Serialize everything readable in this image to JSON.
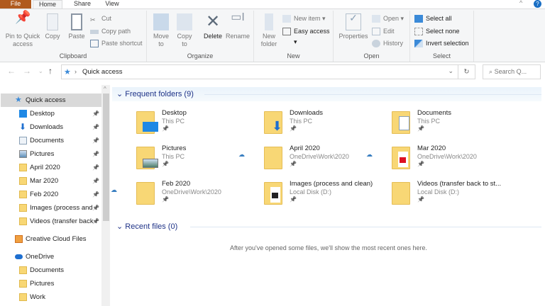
{
  "tabs": {
    "file": "File",
    "home": "Home",
    "share": "Share",
    "view": "View"
  },
  "ribbon": {
    "clipboard": {
      "label": "Clipboard",
      "pin": "Pin to Quick access",
      "copy": "Copy",
      "paste": "Paste",
      "cut": "Cut",
      "copy_path": "Copy path",
      "paste_shortcut": "Paste shortcut"
    },
    "organize": {
      "label": "Organize",
      "move_to": "Move to",
      "copy_to": "Copy to",
      "delete": "Delete",
      "rename": "Rename"
    },
    "new": {
      "label": "New",
      "new_folder": "New folder",
      "new_item": "New item",
      "easy_access": "Easy access"
    },
    "open": {
      "label": "Open",
      "properties": "Properties",
      "open": "Open",
      "edit": "Edit",
      "history": "History"
    },
    "select": {
      "label": "Select",
      "select_all": "Select all",
      "select_none": "Select none",
      "invert": "Invert selection"
    }
  },
  "address": {
    "path": "Quick access",
    "search_placeholder": "Search Q..."
  },
  "sidebar": {
    "items": [
      {
        "label": "Quick access",
        "indent": 0,
        "icon": "star-icon",
        "pinned": false
      },
      {
        "label": "Desktop",
        "indent": 1,
        "icon": "desktop-icon",
        "pinned": true
      },
      {
        "label": "Downloads",
        "indent": 1,
        "icon": "download-icon",
        "pinned": true
      },
      {
        "label": "Documents",
        "indent": 1,
        "icon": "document-icon",
        "pinned": true
      },
      {
        "label": "Pictures",
        "indent": 1,
        "icon": "picture-icon",
        "pinned": true
      },
      {
        "label": "April 2020",
        "indent": 1,
        "icon": "folder-icon",
        "pinned": true
      },
      {
        "label": "Mar 2020",
        "indent": 1,
        "icon": "folder-icon",
        "pinned": true
      },
      {
        "label": "Feb 2020",
        "indent": 1,
        "icon": "folder-icon",
        "pinned": true
      },
      {
        "label": "Images (process and",
        "indent": 1,
        "icon": "folder-icon",
        "pinned": true
      },
      {
        "label": "Videos (transfer back",
        "indent": 1,
        "icon": "folder-icon",
        "pinned": true
      },
      {
        "label": "Creative Cloud Files",
        "indent": 0,
        "icon": "creative-cloud-icon",
        "pinned": false
      },
      {
        "label": "OneDrive",
        "indent": 0,
        "icon": "onedrive-icon",
        "pinned": false
      },
      {
        "label": "Documents",
        "indent": 1,
        "icon": "folder-icon",
        "pinned": false
      },
      {
        "label": "Pictures",
        "indent": 1,
        "icon": "folder-icon",
        "pinned": false
      },
      {
        "label": "Work",
        "indent": 1,
        "icon": "folder-icon",
        "pinned": false
      }
    ]
  },
  "frequent": {
    "header": "Frequent folders (9)",
    "folders": [
      {
        "name": "Desktop",
        "location": "This PC",
        "cloud": false,
        "overlay": "desktop"
      },
      {
        "name": "Downloads",
        "location": "This PC",
        "cloud": false,
        "overlay": "download"
      },
      {
        "name": "Documents",
        "location": "This PC",
        "cloud": false,
        "overlay": "document"
      },
      {
        "name": "Pictures",
        "location": "This PC",
        "cloud": false,
        "overlay": "picture"
      },
      {
        "name": "April 2020",
        "location": "OneDrive\\Work\\2020",
        "cloud": true,
        "overlay": "none"
      },
      {
        "name": "Mar 2020",
        "location": "OneDrive\\Work\\2020",
        "cloud": true,
        "overlay": "pdf"
      },
      {
        "name": "Feb 2020",
        "location": "OneDrive\\Work\\2020",
        "cloud": true,
        "overlay": "none"
      },
      {
        "name": "Images (process and clean)",
        "location": "Local Disk (D:)",
        "cloud": false,
        "overlay": "video"
      },
      {
        "name": "Videos (transfer back to st...",
        "location": "Local Disk (D:)",
        "cloud": false,
        "overlay": "none"
      }
    ]
  },
  "recent": {
    "header": "Recent files (0)",
    "empty_message": "After you've opened some files, we'll show the most recent ones here."
  },
  "colors": {
    "file_tab": "#b05a1e",
    "accent": "#1e3287",
    "folder": "#f8d775"
  }
}
